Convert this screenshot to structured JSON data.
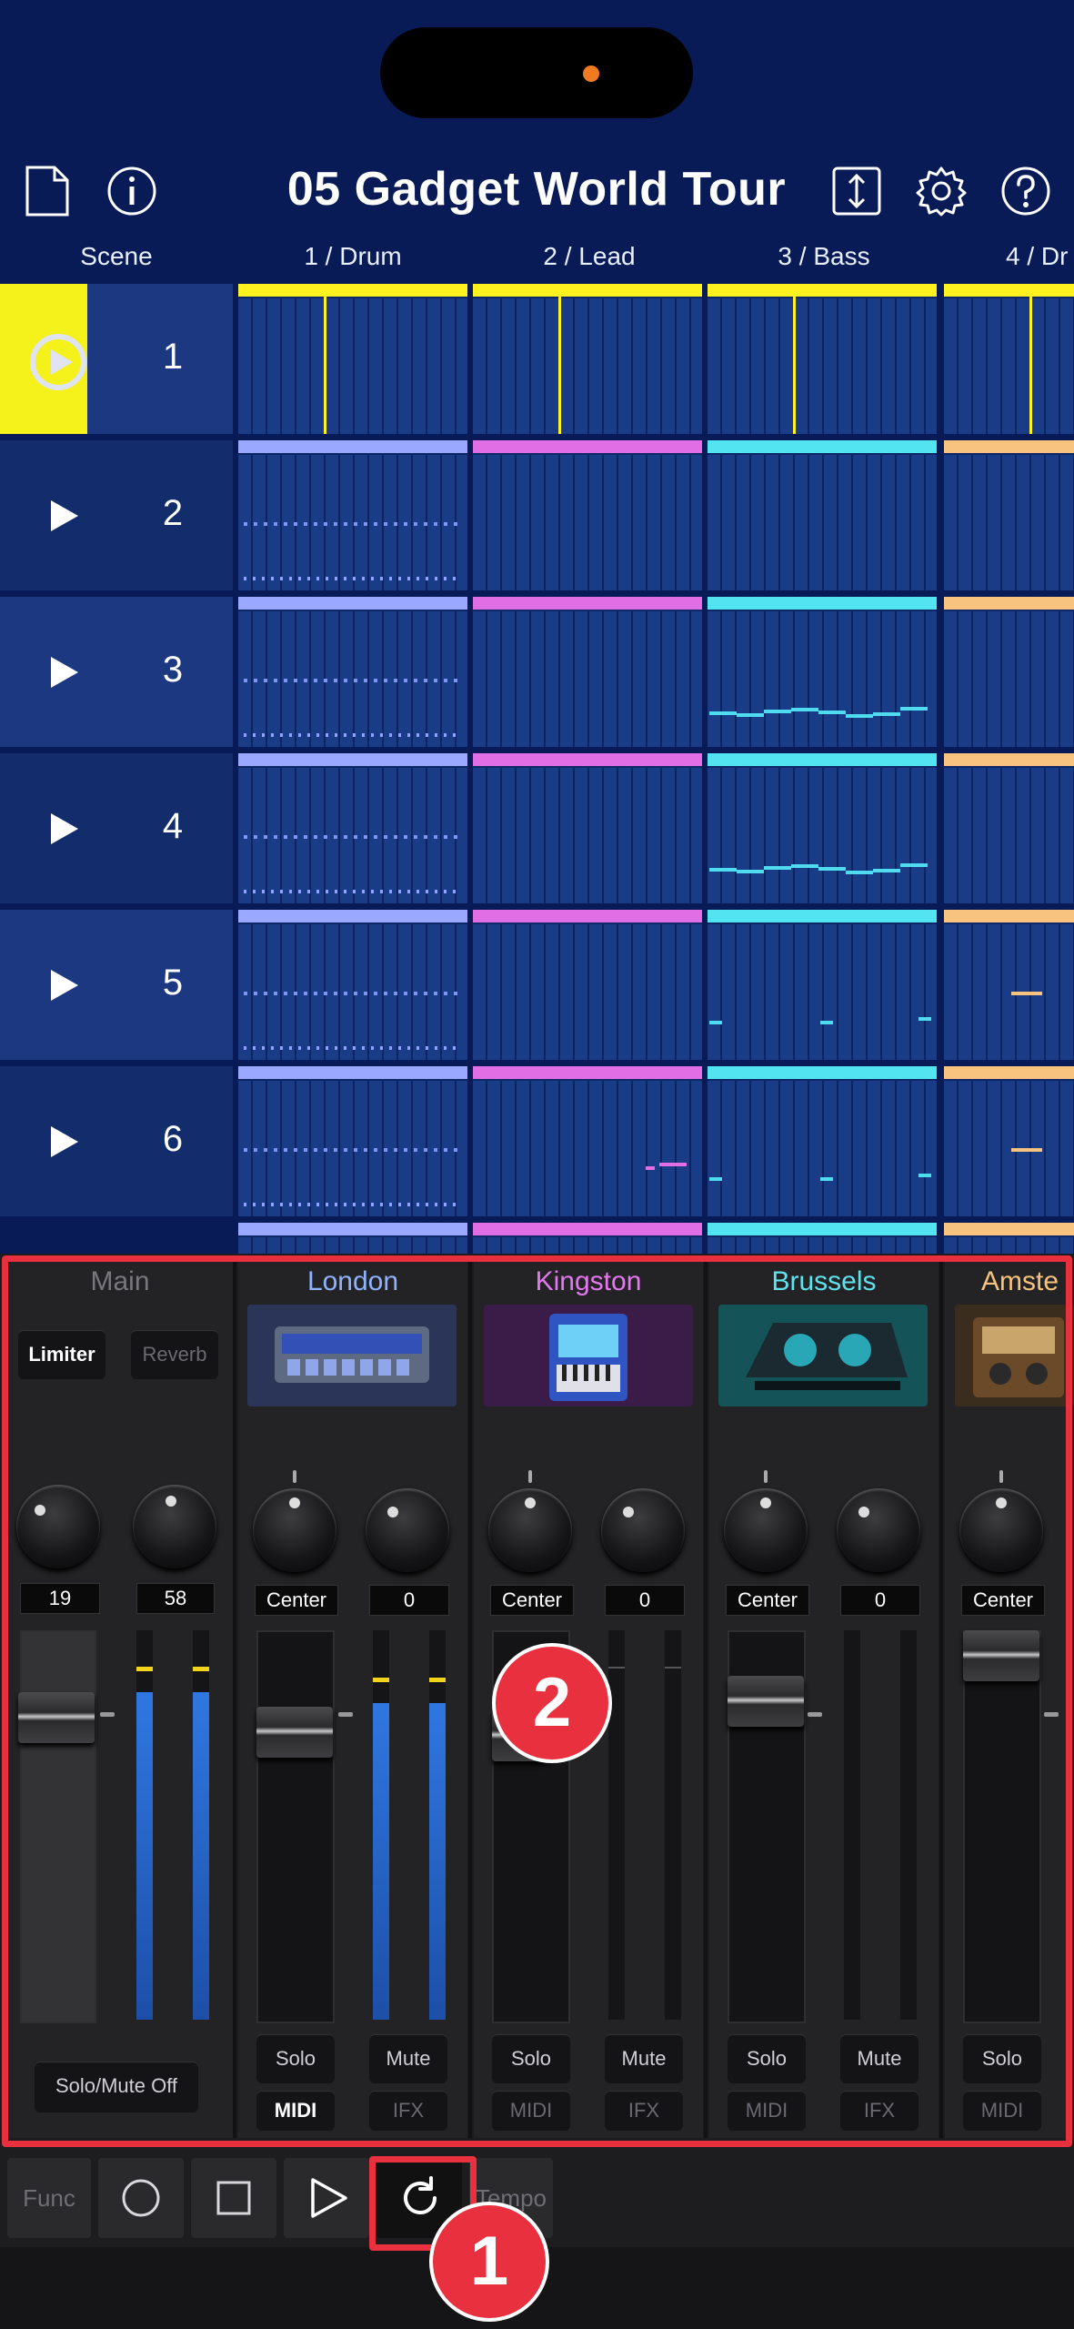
{
  "header": {
    "title": "05 Gadget World Tour",
    "icons": [
      "new-document-icon",
      "info-icon",
      "resize-icon",
      "settings-gear-icon",
      "help-icon"
    ]
  },
  "columns": {
    "scene_label": "Scene",
    "tracks": [
      "1 / Drum",
      "2 / Lead",
      "3 / Bass",
      "4 / Dr"
    ]
  },
  "scenes": [
    "1",
    "2",
    "3",
    "4",
    "5",
    "6"
  ],
  "track_colors": [
    "#9aa8ff",
    "#e26ee6",
    "#52e4f0",
    "#f8c37e"
  ],
  "mixer": {
    "main": {
      "name": "Main",
      "limiter_label": "Limiter",
      "reverb_label": "Reverb",
      "knob_values": [
        "19",
        "58"
      ],
      "solo_mute_off_label": "Solo/Mute Off"
    },
    "gadgets": [
      {
        "name": "London",
        "color": "#8fb3ff",
        "pan": "Center",
        "send": "0",
        "solo": "Solo",
        "mute": "Mute",
        "midi": "MIDI",
        "ifx": "IFX",
        "midi_active": true
      },
      {
        "name": "Kingston",
        "color": "#e478f0",
        "pan": "Center",
        "send": "0",
        "solo": "Solo",
        "mute": "Mute",
        "midi": "MIDI",
        "ifx": "IFX",
        "midi_active": false
      },
      {
        "name": "Brussels",
        "color": "#5ee3ee",
        "pan": "Center",
        "send": "0",
        "solo": "Solo",
        "mute": "Mute",
        "midi": "MIDI",
        "ifx": "IFX",
        "midi_active": false
      },
      {
        "name": "Amste",
        "color": "#f7c27b",
        "pan": "Center",
        "solo": "Solo",
        "midi": "MIDI"
      }
    ]
  },
  "transport": {
    "func_label": "Func",
    "tempo_label": "Tempo",
    "icons": [
      "record-icon",
      "stop-icon",
      "play-icon",
      "loop-icon"
    ]
  },
  "annotations": {
    "badge1": "1",
    "badge2": "2",
    "color": "#e8303f"
  }
}
